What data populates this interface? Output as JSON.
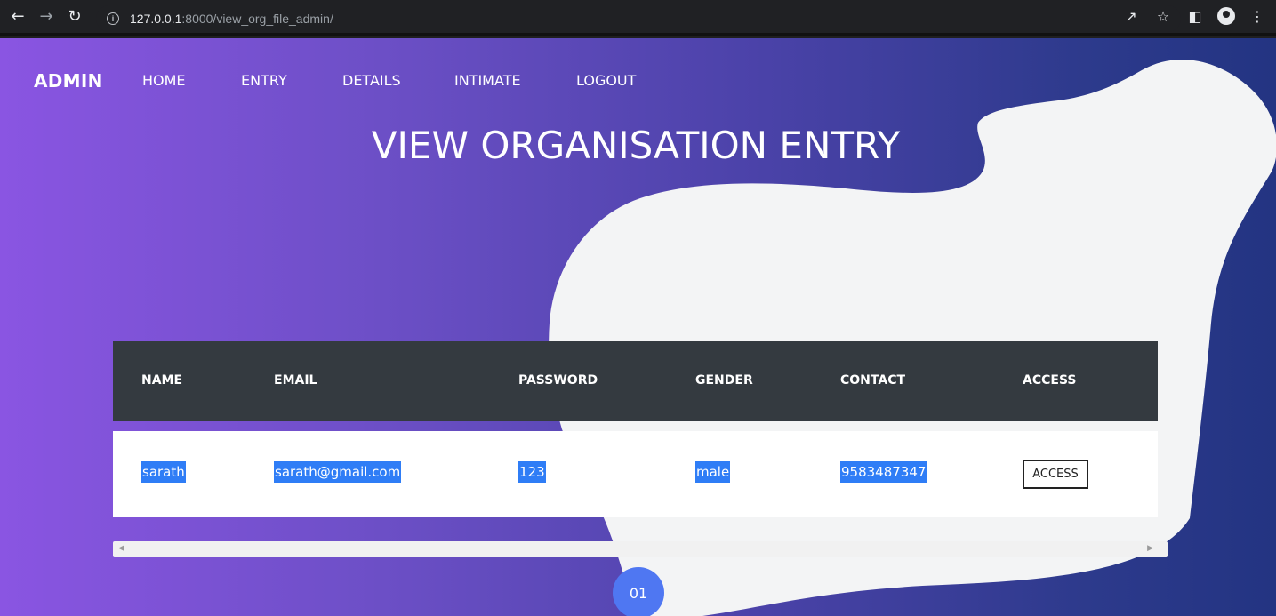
{
  "browser": {
    "url_host": "127.0.0.1",
    "url_path": ":8000/view_org_file_admin/"
  },
  "nav": {
    "brand": "ADMIN",
    "links": [
      "HOME",
      "ENTRY",
      "DETAILS",
      "INTIMATE",
      "LOGOUT"
    ]
  },
  "page_title": "VIEW ORGANISATION ENTRY",
  "table": {
    "headers": [
      "NAME",
      "EMAIL",
      "PASSWORD",
      "GENDER",
      "CONTACT",
      "ACCESS"
    ],
    "rows": [
      {
        "name": "sarath",
        "email": "sarath@gmail.com",
        "password": "123",
        "gender": "male",
        "contact": "9583487347",
        "access_label": "ACCESS"
      }
    ]
  },
  "pagination": {
    "current": "01"
  },
  "colors": {
    "gradient_start": "#8a55e2",
    "gradient_end": "#233482",
    "table_header": "#343a40",
    "selection": "#2f7df6",
    "badge": "#4f77f2"
  }
}
